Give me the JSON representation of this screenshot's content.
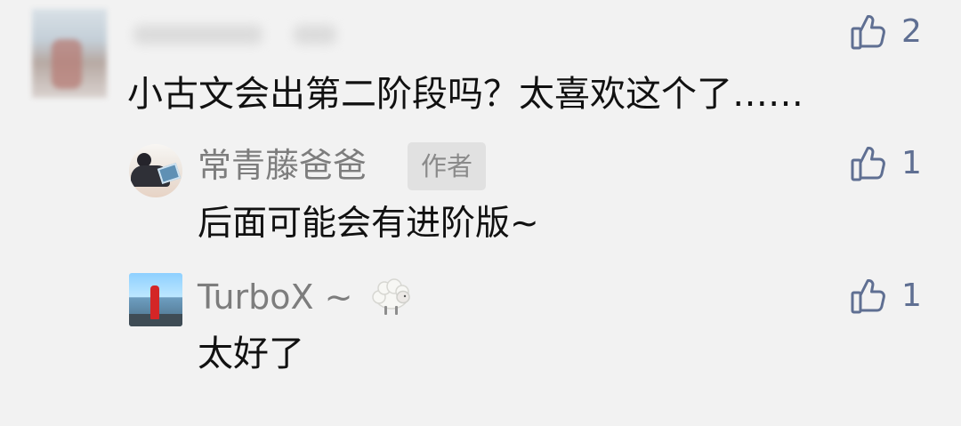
{
  "main_comment": {
    "text": "小古文会出第二阶段吗？太喜欢这个了……",
    "likes": "2"
  },
  "replies": [
    {
      "name": "常青藤爸爸",
      "badge": "作者",
      "text": "后面可能会有进阶版~",
      "likes": "1"
    },
    {
      "name": "TurboX ~",
      "text": "太好了",
      "likes": "1",
      "name_icon": "sheep-icon"
    }
  ],
  "colors": {
    "background": "#f2f2f2",
    "primary_text": "#111111",
    "secondary_text": "#7d7d7d",
    "like_accent": "#5f6f92",
    "badge_background": "#e1e1e1"
  },
  "icons": {
    "like": "thumb-up-icon",
    "avatar": "avatar",
    "name_badge": "sheep-icon"
  }
}
